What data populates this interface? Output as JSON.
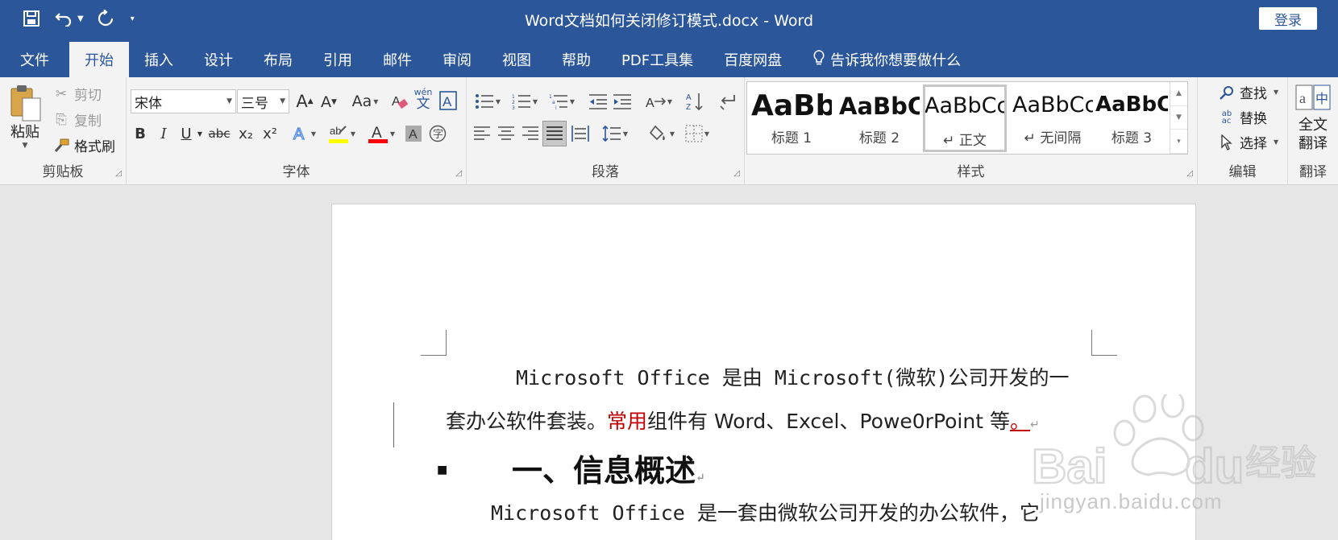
{
  "titlebar": {
    "title": "Word文档如何关闭修订模式.docx  -  Word",
    "login": "登录"
  },
  "tabs": [
    "文件",
    "开始",
    "插入",
    "设计",
    "布局",
    "引用",
    "邮件",
    "审阅",
    "视图",
    "帮助",
    "PDF工具集",
    "百度网盘"
  ],
  "tell_me": "告诉我你想要做什么",
  "clipboard": {
    "paste": "粘贴",
    "cut": "剪切",
    "copy": "复制",
    "format_painter": "格式刷",
    "label": "剪贴板"
  },
  "font": {
    "name": "宋体",
    "size": "三号",
    "label": "字体",
    "grow": "A",
    "shrink": "A",
    "case": "Aa",
    "phonetic": "wén\n文",
    "bold": "B",
    "italic": "I",
    "underline": "U",
    "strike": "abc",
    "subscript": "x₂",
    "superscript": "x²",
    "color_a": "A"
  },
  "paragraph": {
    "label": "段落"
  },
  "styles": {
    "label": "样式",
    "items": [
      {
        "preview": "AaBb",
        "name": "标题 1"
      },
      {
        "preview": "AaBbC",
        "name": "标题 2"
      },
      {
        "preview": "AaBbCc",
        "name": "↵ 正文"
      },
      {
        "preview": "AaBbCc",
        "name": "↵ 无间隔"
      },
      {
        "preview": "AaBbC",
        "name": "标题 3"
      }
    ]
  },
  "editing": {
    "find": "查找",
    "replace": "替换",
    "select": "选择",
    "label": "编辑"
  },
  "translate": {
    "full": "全文",
    "translate": "翻译",
    "label": "翻译"
  },
  "document": {
    "p1_line1": "Microsoft  Office 是由 Microsoft(微软)公司开发的一",
    "p1_line2_a": "套办公软件套装。",
    "p1_line2_red": "常用",
    "p1_line2_b": "组件有 Word、Excel、Powe0rPoint 等",
    "p1_line2_red2": "。",
    "heading": "一、信息概述",
    "p2_line1": "Microsoft  Office 是一套由微软公司开发的办公软件，它"
  },
  "watermark": {
    "text": "jingyan.baidu.com",
    "brand": "Baidu",
    "brand_cn": "经验"
  },
  "colors": {
    "title_bg": "#2b579a",
    "ribbon_bg": "#f3f3f3",
    "revision_red": "#c00000",
    "highlight_yellow": "#ffff00",
    "font_color_red": "#ff0000"
  }
}
